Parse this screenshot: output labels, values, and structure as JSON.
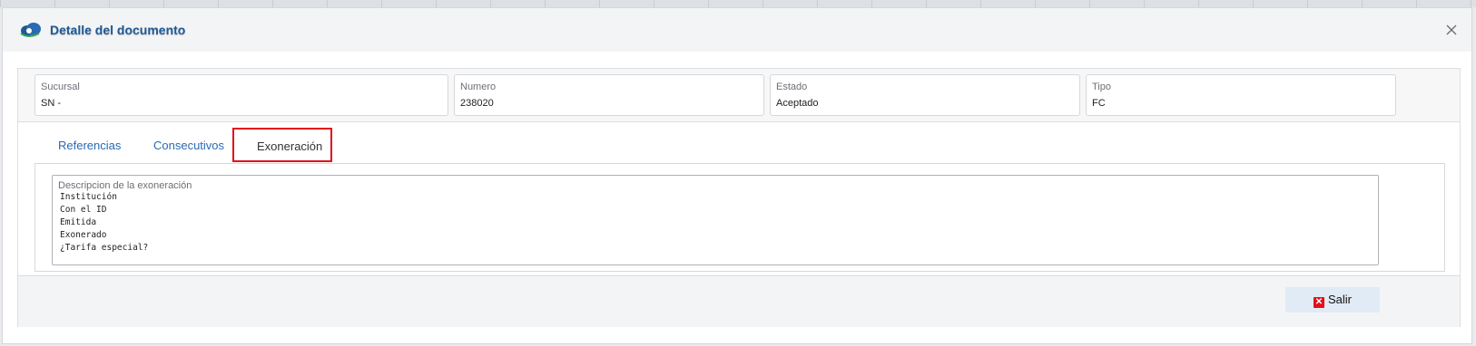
{
  "dialog": {
    "title": "Detalle del documento"
  },
  "info": [
    {
      "label": "Sucursal",
      "value": "SN - "
    },
    {
      "label": "Numero",
      "value": "238020"
    },
    {
      "label": "Estado",
      "value": "Aceptado"
    },
    {
      "label": "Tipo",
      "value": "FC"
    }
  ],
  "tabs": {
    "referencias": "Referencias",
    "consecutivos": "Consecutivos",
    "exoneracion": "Exoneración"
  },
  "exoneration": {
    "label": "Descripcion de la exoneración",
    "lines": [
      "Institución",
      "Con el ID",
      "Emitida",
      "Exonerado",
      "¿Tarifa especial?"
    ]
  },
  "footer": {
    "salir_label": "Salir"
  },
  "colors": {
    "title": "#1d5a94",
    "tab_link": "#2a6ab2",
    "highlight": "#e3101a",
    "button_bg": "#e1ebf6"
  },
  "icons": {
    "logo": "cloud-logo-icon",
    "close": "close-icon",
    "salir": "close-box-icon"
  }
}
